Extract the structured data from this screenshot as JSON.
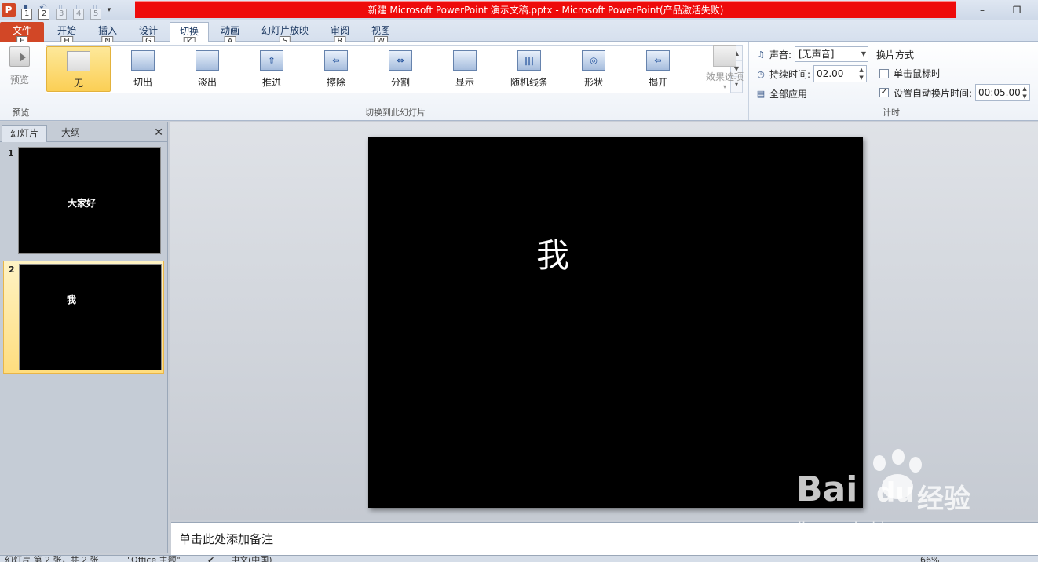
{
  "window": {
    "title": "新建 Microsoft PowerPoint 演示文稿.pptx  -  Microsoft PowerPoint(产品激活失败)",
    "app_icon": "P",
    "qat_keytips": [
      "1",
      "2",
      "3",
      "4",
      "5"
    ]
  },
  "tabs": [
    {
      "label": "文件",
      "keytip": "F"
    },
    {
      "label": "开始",
      "keytip": "H"
    },
    {
      "label": "插入",
      "keytip": "N"
    },
    {
      "label": "设计",
      "keytip": "G"
    },
    {
      "label": "切换",
      "keytip": "K"
    },
    {
      "label": "动画",
      "keytip": "A"
    },
    {
      "label": "幻灯片放映",
      "keytip": "S"
    },
    {
      "label": "审阅",
      "keytip": "R"
    },
    {
      "label": "视图",
      "keytip": "W"
    }
  ],
  "ribbon": {
    "preview": {
      "button_label": "预览",
      "group_label": "预览"
    },
    "transitions": {
      "group_label": "切换到此幻灯片",
      "items": [
        {
          "label": "无",
          "icon": "none-transition-icon",
          "glyph": ""
        },
        {
          "label": "切出",
          "icon": "cut-transition-icon",
          "glyph": ""
        },
        {
          "label": "淡出",
          "icon": "fade-transition-icon",
          "glyph": ""
        },
        {
          "label": "推进",
          "icon": "push-transition-icon",
          "glyph": "⇧"
        },
        {
          "label": "擦除",
          "icon": "wipe-transition-icon",
          "glyph": "⇦"
        },
        {
          "label": "分割",
          "icon": "split-transition-icon",
          "glyph": "⇔"
        },
        {
          "label": "显示",
          "icon": "reveal-transition-icon",
          "glyph": ""
        },
        {
          "label": "随机线条",
          "icon": "random-bars-transition-icon",
          "glyph": "|||"
        },
        {
          "label": "形状",
          "icon": "shape-transition-icon",
          "glyph": "◎"
        },
        {
          "label": "揭开",
          "icon": "uncover-transition-icon",
          "glyph": "⇦"
        }
      ],
      "effect_options_label": "效果选项"
    },
    "timing": {
      "group_label": "计时",
      "sound_label": "声音:",
      "sound_value": "[无声音]",
      "duration_label": "持续时间:",
      "duration_value": "02.00",
      "apply_all_label": "全部应用",
      "advance_label": "换片方式",
      "on_click_label": "单击鼠标时",
      "on_click_checked": false,
      "after_label": "设置自动换片时间:",
      "after_checked": true,
      "after_value": "00:05.00"
    }
  },
  "left_panel": {
    "tabs": [
      "幻灯片",
      "大纲"
    ],
    "slides": [
      {
        "number": "1",
        "text": "大家好"
      },
      {
        "number": "2",
        "text": "我"
      }
    ]
  },
  "slide": {
    "text": "我"
  },
  "notes_placeholder": "单击此处添加备注",
  "status": {
    "slide_info": "幻灯片 第 2 张，共 2 张",
    "theme": "\"Office 主题\"",
    "language": "中文(中国)",
    "zoom": "66%"
  },
  "watermark": {
    "text1": "Bai",
    "text2": "du",
    "text3": "经验",
    "url": "jingyan.baidu.com"
  }
}
